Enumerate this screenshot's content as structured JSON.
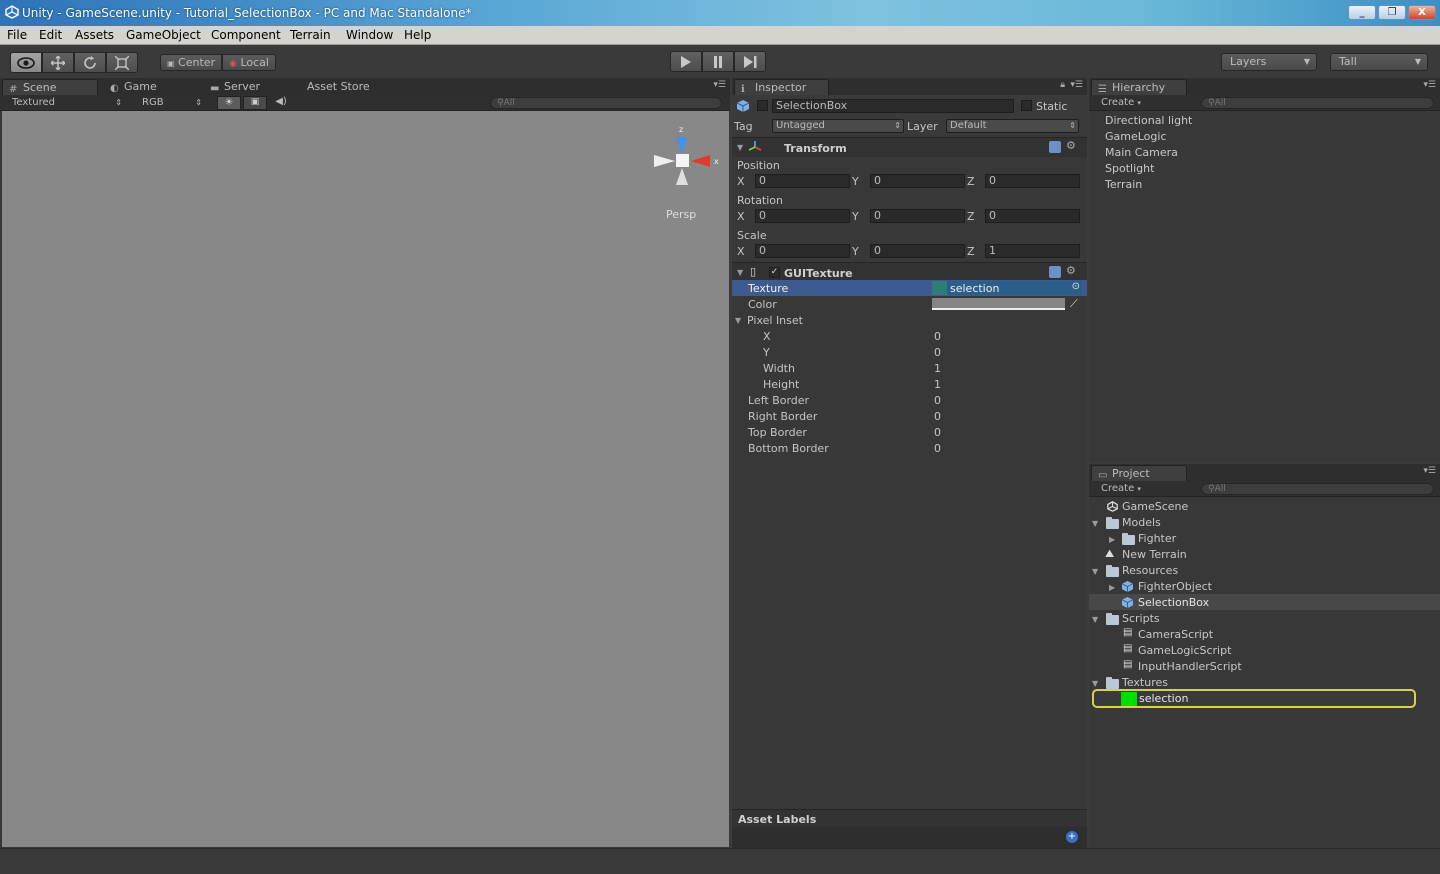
{
  "window": {
    "title": "Unity - GameScene.unity - Tutorial_SelectionBox - PC and Mac Standalone*",
    "controls": {
      "minimize": "_",
      "restore": "❐",
      "close": "X"
    }
  },
  "menu": [
    "File",
    "Edit",
    "Assets",
    "GameObject",
    "Component",
    "Terrain",
    "Window",
    "Help"
  ],
  "toolbar": {
    "pivot_center": "Center",
    "pivot_local": "Local",
    "layers": "Layers",
    "layout": "Tall"
  },
  "scene_panel": {
    "tabs": [
      "Scene",
      "Game",
      "Server",
      "Asset Store"
    ],
    "render_mode": "Textured",
    "color_mode": "RGB",
    "search_placeholder": "All",
    "gizmo": {
      "y_axis": "z",
      "x_axis": "x",
      "projection": "Persp"
    }
  },
  "inspector": {
    "tab": "Inspector",
    "object_name": "SelectionBox",
    "static_label": "Static",
    "tag_label": "Tag",
    "tag_value": "Untagged",
    "layer_label": "Layer",
    "layer_value": "Default",
    "transform": {
      "title": "Transform",
      "position_label": "Position",
      "position": {
        "x": "0",
        "y": "0",
        "z": "0"
      },
      "rotation_label": "Rotation",
      "rotation": {
        "x": "0",
        "y": "0",
        "z": "0"
      },
      "scale_label": "Scale",
      "scale": {
        "x": "0",
        "y": "0",
        "z": "1"
      },
      "axis_x": "X",
      "axis_y": "Y",
      "axis_z": "Z"
    },
    "gui_texture": {
      "title": "GUITexture",
      "texture_label": "Texture",
      "texture_value": "selection",
      "color_label": "Color",
      "pixel_inset_label": "Pixel Inset",
      "inset_x_label": "X",
      "inset_x": "0",
      "inset_y_label": "Y",
      "inset_y": "0",
      "width_label": "Width",
      "width": "1",
      "height_label": "Height",
      "height": "1",
      "left_border_label": "Left Border",
      "left_border": "0",
      "right_border_label": "Right Border",
      "right_border": "0",
      "top_border_label": "Top Border",
      "top_border": "0",
      "bottom_border_label": "Bottom Border",
      "bottom_border": "0"
    },
    "asset_labels": "Asset Labels"
  },
  "hierarchy": {
    "tab": "Hierarchy",
    "create": "Create",
    "search_placeholder": "All",
    "items": [
      "Directional light",
      "GameLogic",
      "Main Camera",
      "Spotlight",
      "Terrain"
    ]
  },
  "project": {
    "tab": "Project",
    "create": "Create",
    "search_placeholder": "All",
    "items": {
      "gamescene": "GameScene",
      "models": "Models",
      "fighter": "Fighter",
      "new_terrain": "New Terrain",
      "resources": "Resources",
      "fighter_object": "FighterObject",
      "selection_box": "SelectionBox",
      "scripts": "Scripts",
      "camera_script": "CameraScript",
      "gamelogic_script": "GameLogicScript",
      "input_handler_script": "InputHandlerScript",
      "textures": "Textures",
      "selection": "selection"
    },
    "selection_color": "#00e000"
  }
}
